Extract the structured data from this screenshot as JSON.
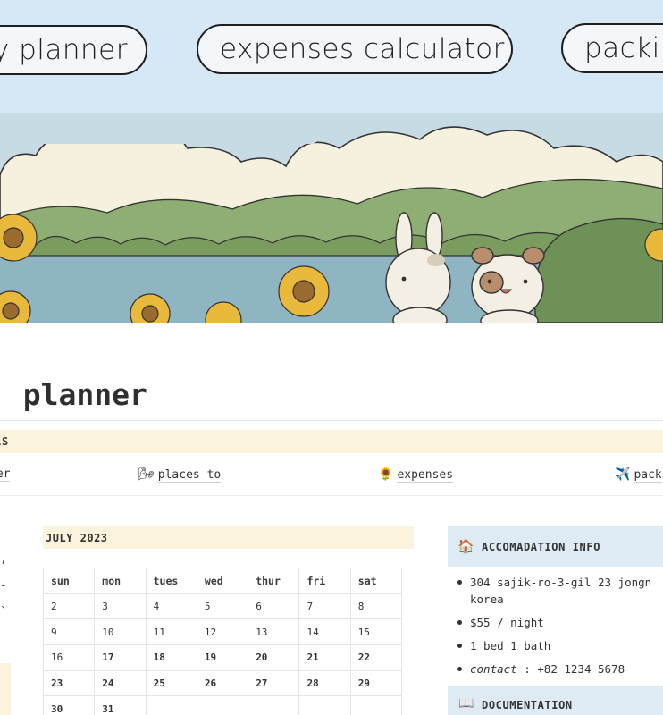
{
  "nav": {
    "pills": [
      {
        "label": "y planner"
      },
      {
        "label": "expenses calculator"
      },
      {
        "label": "packi"
      }
    ]
  },
  "page": {
    "title": ". planner"
  },
  "links_section": {
    "heading": "LS",
    "links": [
      {
        "icon": "",
        "label": "ner"
      },
      {
        "icon": "🌬",
        "label": "places to"
      },
      {
        "icon": "🌻",
        "label": "expenses"
      },
      {
        "icon": "✈️",
        "label": "pack"
      }
    ]
  },
  "left_fragments": [
    "-"
  ],
  "calendar": {
    "heading": "JULY 2023",
    "days": [
      "sun",
      "mon",
      "tues",
      "wed",
      "thur",
      "fri",
      "sat"
    ],
    "weeks": [
      [
        "2",
        "3",
        "4",
        "5",
        "6",
        "7",
        "8"
      ],
      [
        "9",
        "10",
        "11",
        "12",
        "13",
        "14",
        "15"
      ],
      [
        "16",
        "17",
        "18",
        "19",
        "20",
        "21",
        "22"
      ],
      [
        "23",
        "24",
        "25",
        "26",
        "27",
        "28",
        "29"
      ],
      [
        "30",
        "31",
        "",
        "",
        "",
        "",
        ""
      ]
    ]
  },
  "accommodation": {
    "icon": "🏠",
    "heading": "ACCOMADATION INFO",
    "items": [
      {
        "text": "304 sajik-ro-3-gil 23 jongn"
      },
      {
        "text": "korea"
      },
      {
        "text": "$55 / night"
      },
      {
        "text": "1 bed 1 bath"
      },
      {
        "label": "contact",
        "text": " : +82 1234 5678"
      }
    ]
  },
  "documentation": {
    "icon": "📖",
    "heading": "DOCUMENTATION"
  },
  "colors": {
    "nav_bg": "#d6e8f5",
    "section_band": "#fbf3dc",
    "callout_blue": "#deebf4"
  }
}
